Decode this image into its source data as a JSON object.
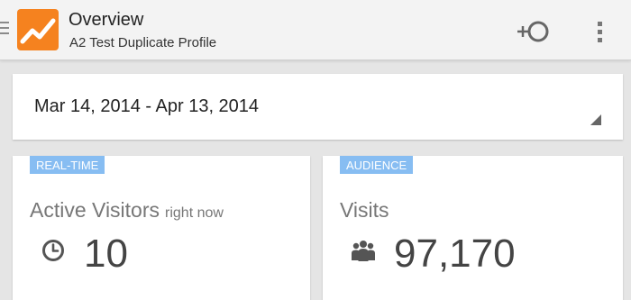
{
  "app_bar": {
    "title": "Overview",
    "subtitle": "A2 Test Duplicate Profile",
    "icons": [
      "menu-lines-icon",
      "analytics-logo-icon",
      "add-segment-icon",
      "overflow-menu-icon"
    ]
  },
  "date_selector": {
    "range": "Mar 14, 2014 - Apr 13, 2014"
  },
  "cards": [
    {
      "badge": "REAL-TIME",
      "label": "Active Visitors",
      "sublabel": "right now",
      "value": "10",
      "icon": "clock-icon"
    },
    {
      "badge": "AUDIENCE",
      "label": "Visits",
      "sublabel": "",
      "value": "97,170",
      "icon": "people-icon"
    }
  ],
  "colors": {
    "logo_orange": "#f5821f",
    "badge_blue": "#87bdf2",
    "app_bar_bg": "#f3f3f3",
    "page_bg": "#e5e5e5"
  }
}
